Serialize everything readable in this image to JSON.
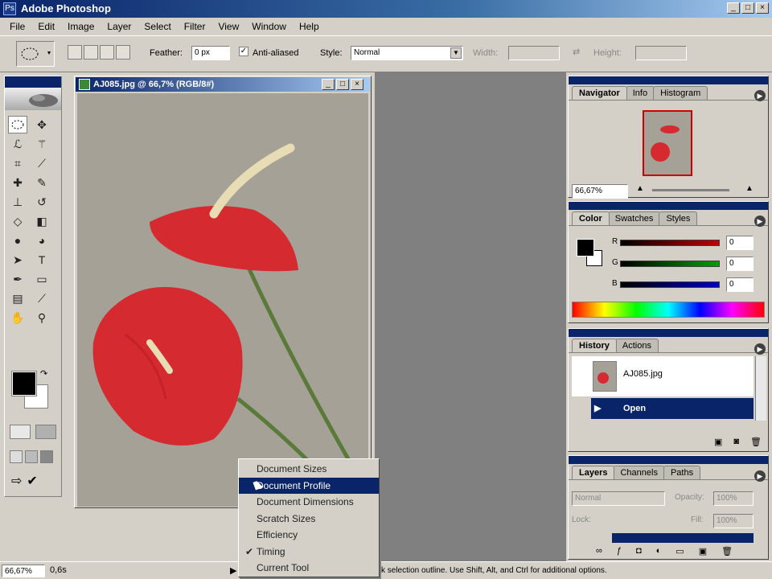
{
  "window": {
    "title": "Adobe Photoshop",
    "min_glyph": "_",
    "max_glyph": "□",
    "close_glyph": "×"
  },
  "menubar": [
    "File",
    "Edit",
    "Image",
    "Layer",
    "Select",
    "Filter",
    "View",
    "Window",
    "Help"
  ],
  "options": {
    "feather_label": "Feather:",
    "feather_value": "0 px",
    "antialiased_label": "Anti-aliased",
    "style_label": "Style:",
    "style_value": "Normal",
    "width_label": "Width:",
    "height_label": "Height:"
  },
  "document": {
    "title": "AJ085.jpg @ 66,7% (RGB/8#)"
  },
  "navigator": {
    "tabs": [
      "Navigator",
      "Info",
      "Histogram"
    ],
    "zoom": "66,67%"
  },
  "color_panel": {
    "tabs": [
      "Color",
      "Swatches",
      "Styles"
    ],
    "channels": [
      {
        "label": "R",
        "value": "0",
        "color": "#c00000"
      },
      {
        "label": "G",
        "value": "0",
        "color": "#00a000"
      },
      {
        "label": "B",
        "value": "0",
        "color": "#0000c0"
      }
    ]
  },
  "history_panel": {
    "tabs": [
      "History",
      "Actions"
    ],
    "snapshot_name": "AJ085.jpg",
    "step_name": "Open"
  },
  "layers_panel": {
    "tabs": [
      "Layers",
      "Channels",
      "Paths"
    ],
    "blend_mode": "Normal",
    "opacity_label": "Opacity:",
    "opacity_value": "100%",
    "fill_label": "Fill:",
    "fill_value": "100%",
    "lock_label": "Lock:"
  },
  "status": {
    "zoom": "66,67%",
    "info": "0,6s",
    "hint": "k selection outline. Use Shift, Alt, and Ctrl for additional options."
  },
  "context_menu": {
    "items": [
      {
        "label": "Document Sizes",
        "highlighted": false,
        "checked": false
      },
      {
        "label": "Document Profile",
        "highlighted": true,
        "checked": false
      },
      {
        "label": "Document Dimensions",
        "highlighted": false,
        "checked": false
      },
      {
        "label": "Scratch Sizes",
        "highlighted": false,
        "checked": false
      },
      {
        "label": "Efficiency",
        "highlighted": false,
        "checked": false
      },
      {
        "label": "Timing",
        "highlighted": false,
        "checked": true
      },
      {
        "label": "Current Tool",
        "highlighted": false,
        "checked": false
      }
    ],
    "check_glyph": "✔"
  },
  "colors": {
    "titlebar": "#0a246a",
    "selection": "#0a246a",
    "flower_red": "#d42a30",
    "canvas_bg": "#a5a197"
  },
  "tools": [
    "marquee-icon",
    "move-icon",
    "lasso-icon",
    "magic-wand-icon",
    "crop-icon",
    "slice-icon",
    "healing-icon",
    "brush-icon",
    "clone-stamp-icon",
    "history-brush-icon",
    "eraser-icon",
    "gradient-icon",
    "blur-icon",
    "dodge-icon",
    "path-select-icon",
    "type-icon",
    "pen-icon",
    "shape-icon",
    "notes-icon",
    "eyedropper-icon",
    "hand-icon",
    "zoom-icon"
  ]
}
